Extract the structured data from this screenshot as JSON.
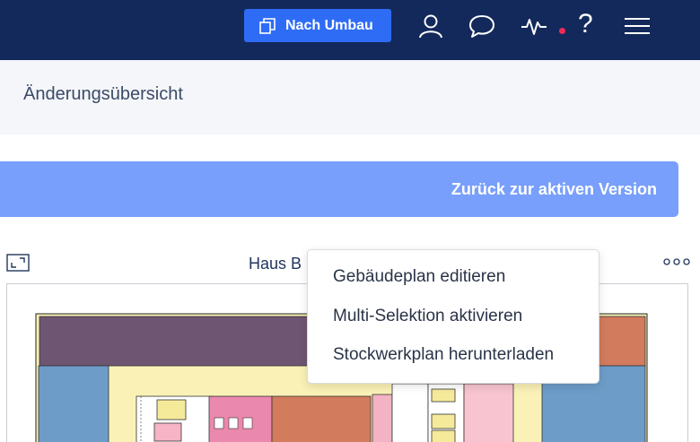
{
  "header": {
    "version_button_label": "Nach Umbau",
    "icons": [
      "copy-icon",
      "user-icon",
      "chat-icon",
      "activity-icon",
      "help-icon",
      "menu-icon"
    ],
    "help_glyph": "?",
    "accent_color": "#2f6cf6",
    "bar_color": "#13295c",
    "notification_color": "#ee2b55"
  },
  "page": {
    "title": "Änderungsübersicht",
    "back_button_label": "Zurück zur aktiven Version"
  },
  "plan": {
    "title": "Haus B"
  },
  "context_menu": {
    "items": [
      {
        "label": "Gebäudeplan editieren"
      },
      {
        "label": "Multi-Selektion aktivieren"
      },
      {
        "label": "Stockwerkplan herunterladen"
      }
    ]
  }
}
